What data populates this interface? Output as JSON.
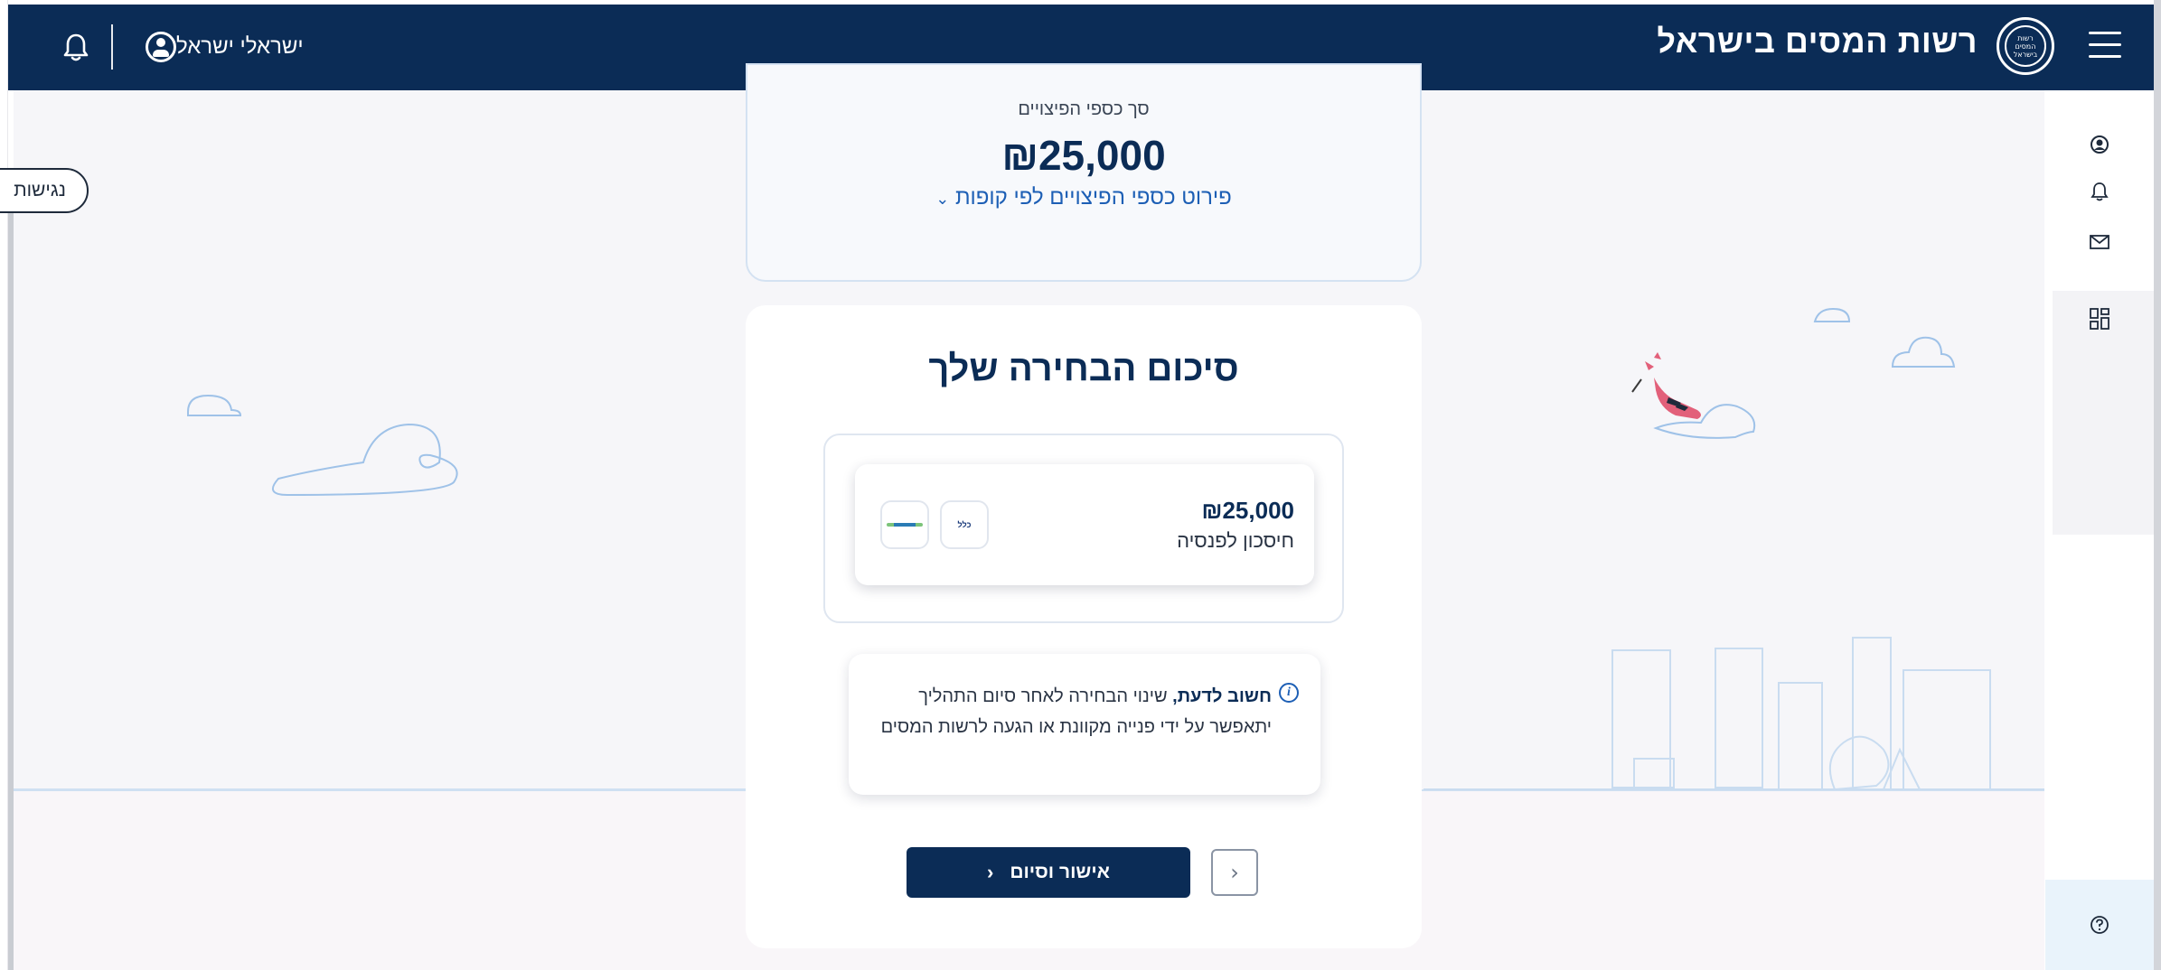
{
  "header": {
    "brand_title": "רשות המסים בישראל",
    "logo_text": "רשות המסים בישראל",
    "user_name": "ישראלי ישראל"
  },
  "accessibility": {
    "label": "נגישות"
  },
  "severance": {
    "label": "סך כספי הפיצויים",
    "amount": "₪25,000",
    "breakdown_link": "פירוט כספי הפיצויים לפי קופות"
  },
  "summary": {
    "title": "סיכום הבחירה שלך",
    "fund": {
      "amount": "₪25,000",
      "type": "חיסכון לפנסיה",
      "logos": [
        "כלל",
        "logo"
      ]
    },
    "notice": {
      "bold": "חשוב לדעת,",
      "text": " שינוי הבחירה לאחר סיום התהליך יתאפשר על ידי פנייה מקוונת או הגעה לרשות המסים"
    },
    "confirm_label": "אישור וסיום"
  },
  "colors": {
    "primary": "#0b2c56",
    "link": "#1d5fb5",
    "background": "#f6f6f9"
  },
  "icons": [
    "menu-icon",
    "user-icon",
    "bell-icon",
    "mail-icon",
    "dashboard-icon",
    "help-icon",
    "chevron-left-icon",
    "chevron-down-icon",
    "info-icon"
  ]
}
